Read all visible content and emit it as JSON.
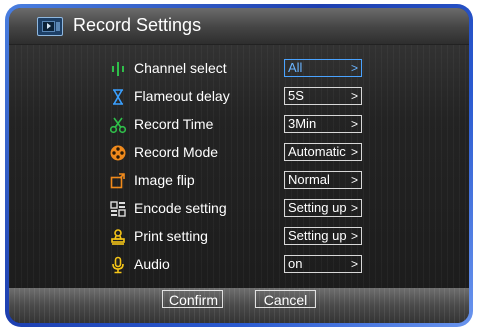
{
  "title": "Record Settings",
  "settings": [
    {
      "label": "Channel select",
      "value": "All",
      "icon": "channel-icon"
    },
    {
      "label": "Flameout delay",
      "value": "5S",
      "icon": "hourglass-icon"
    },
    {
      "label": "Record Time",
      "value": "3Min",
      "icon": "scissors-icon"
    },
    {
      "label": "Record Mode",
      "value": "Automatic",
      "icon": "record-mode-icon"
    },
    {
      "label": "Image flip",
      "value": "Normal",
      "icon": "image-flip-icon"
    },
    {
      "label": "Encode setting",
      "value": "Setting up",
      "icon": "encode-icon"
    },
    {
      "label": "Print setting",
      "value": "Setting up",
      "icon": "print-stamp-icon"
    },
    {
      "label": "Audio",
      "value": "on",
      "icon": "microphone-icon"
    }
  ],
  "chevron": ">",
  "buttons": {
    "confirm": "Confirm",
    "cancel": "Cancel"
  },
  "colors": {
    "label": "#ffffff",
    "selected": "#4aa3ff",
    "icon_green": "#2fbf4a",
    "icon_blue": "#3aa0ff",
    "icon_orange": "#f08a1c",
    "icon_yellow": "#f5c518"
  }
}
